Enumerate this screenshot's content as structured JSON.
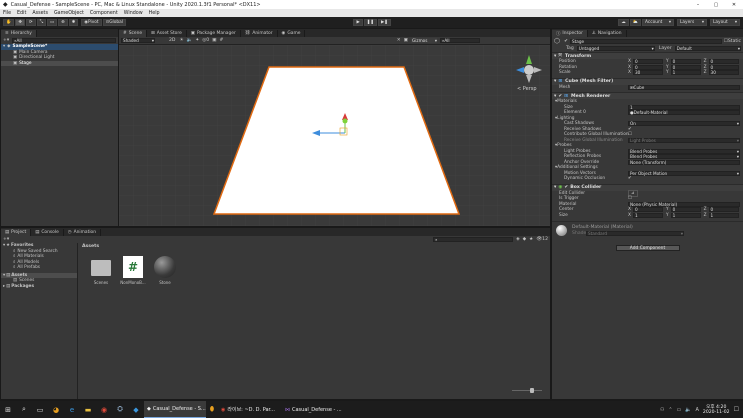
{
  "window": {
    "title": "Casual_Defense - SampleScene - PC, Mac & Linux Standalone - Unity 2020.1.3f1 Personal* <DX11>"
  },
  "menu": [
    "File",
    "Edit",
    "Assets",
    "GameObject",
    "Component",
    "Window",
    "Help"
  ],
  "toolbar": {
    "pivot": "Pivot",
    "global": "Global",
    "account": "Account",
    "layers": "Layers",
    "layout": "Layout"
  },
  "hierarchy": {
    "tab": "Hierarchy",
    "search_placeholder": "All",
    "scene": "SampleScene*",
    "items": [
      "Main Camera",
      "Directional Light",
      "Stage"
    ]
  },
  "scene_tabs": [
    "Scene",
    "Asset Store",
    "Package Manager",
    "Animator",
    "Game"
  ],
  "scene_toolbar": {
    "shading": "Shaded",
    "mode": "2D",
    "gizmos": "Gizmos",
    "search": "All"
  },
  "gizmo": {
    "persp": "< Persp"
  },
  "project": {
    "tabs": [
      "Project",
      "Console",
      "Animation"
    ],
    "favorites": "Favorites",
    "fav_items": [
      "New Saved Search",
      "All Materials",
      "All Models",
      "All Prefabs"
    ],
    "assets": "Assets",
    "asset_children": [
      "Scenes"
    ],
    "packages": "Packages",
    "breadcrumb": "Assets",
    "files": [
      {
        "name": "Scenes",
        "kind": "folder"
      },
      {
        "name": "NonMonoB...",
        "kind": "script"
      },
      {
        "name": "Stone",
        "kind": "material"
      }
    ],
    "count": "12"
  },
  "inspector": {
    "tabs": [
      "Inspector",
      "Navigation"
    ],
    "name": "Stage",
    "static": "Static",
    "tag": "Untagged",
    "layer": "Default",
    "transform": {
      "title": "Transform",
      "position": [
        "0",
        "0",
        "0"
      ],
      "rotation": [
        "0",
        "0",
        "0"
      ],
      "scale": [
        "30",
        "1",
        "30"
      ]
    },
    "mesh_filter": {
      "title": "Cube (Mesh Filter)",
      "mesh": "Cube"
    },
    "mesh_renderer": {
      "title": "Mesh Renderer",
      "materials": "Materials",
      "size": "1",
      "element0": "Default-Material",
      "lighting": "Lighting",
      "cast_shadows": "On",
      "receive_shadows": "Receive Shadows",
      "contribute_gi": "Contribute Global Illumination",
      "receive_gi": "Receive Global Illumination",
      "receive_gi_value": "Light Probes",
      "probes": "Probes",
      "light_probes": "Blend Probes",
      "reflection_probes": "Blend Probes",
      "anchor_override": "None (Transform)",
      "additional": "Additional Settings",
      "motion_vectors": "Per Object Motion",
      "dynamic_occlusion": "Dynamic Occlusion"
    },
    "box_collider": {
      "title": "Box Collider",
      "edit_collider": "Edit Collider",
      "is_trigger": "Is Trigger",
      "material": "None (Physic Material)",
      "center": [
        "0",
        "0",
        "0"
      ],
      "size": [
        "1",
        "1",
        "1"
      ]
    },
    "default_material": {
      "name": "Default-Material (Material)",
      "shader_label": "Shader",
      "shader": "Standard"
    },
    "add_component": "Add Component"
  },
  "taskbar": {
    "apps": [
      "Casual_Defense - S...",
      "라이브: ~D. D. Par...",
      "Casual_Defense - ..."
    ],
    "time": "오후 4:20",
    "date": "2020-11-02"
  }
}
